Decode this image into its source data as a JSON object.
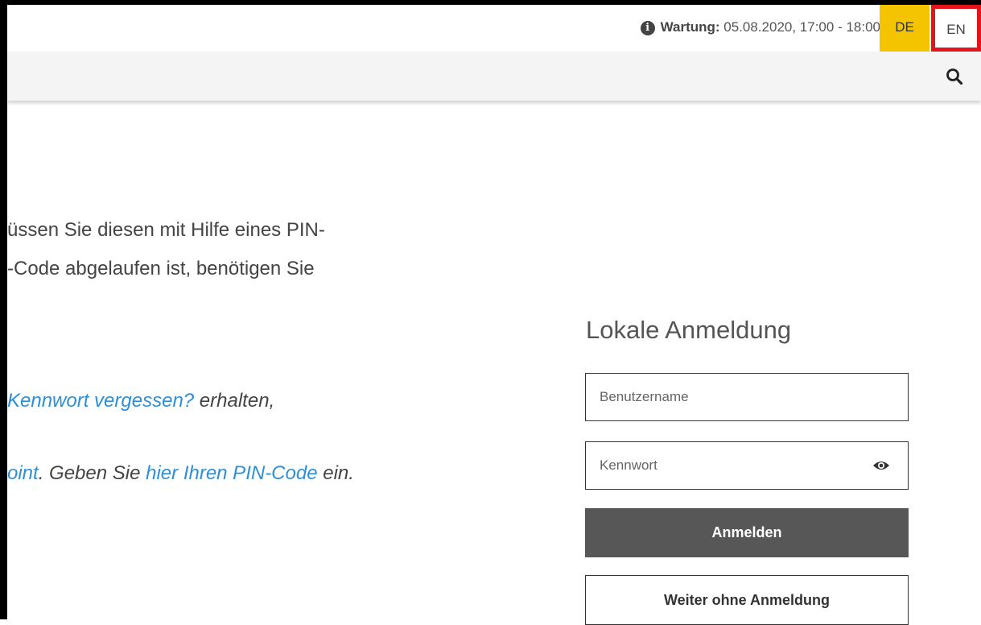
{
  "topbar": {
    "maintenance_label": "Wartung:",
    "maintenance_text": " 05.08.2020, 17:00 - 18:00",
    "lang_de": "DE",
    "lang_en": "EN"
  },
  "content": {
    "line1": "üssen Sie diesen mit Hilfe eines PIN-",
    "line2": "-Code abgelaufen ist, benötigen Sie",
    "line3_link": "Kennwort vergessen?",
    "line3_rest": " erhalten,",
    "line4_link1": "oint",
    "line4_mid": ". Geben Sie ",
    "line4_link2": "hier Ihren PIN-Code",
    "line4_rest": " ein."
  },
  "login": {
    "title": "Lokale Anmeldung",
    "username_placeholder": "Benutzername",
    "password_placeholder": "Kennwort",
    "login_button": "Anmelden",
    "guest_button": "Weiter ohne Anmeldung"
  },
  "icons": {
    "info": "info-icon",
    "search": "search-icon",
    "eye": "eye-icon"
  },
  "colors": {
    "lang_active": "#f5c400",
    "highlight_border": "#e3151a",
    "link": "#2d8fd8",
    "login_button": "#575757"
  }
}
